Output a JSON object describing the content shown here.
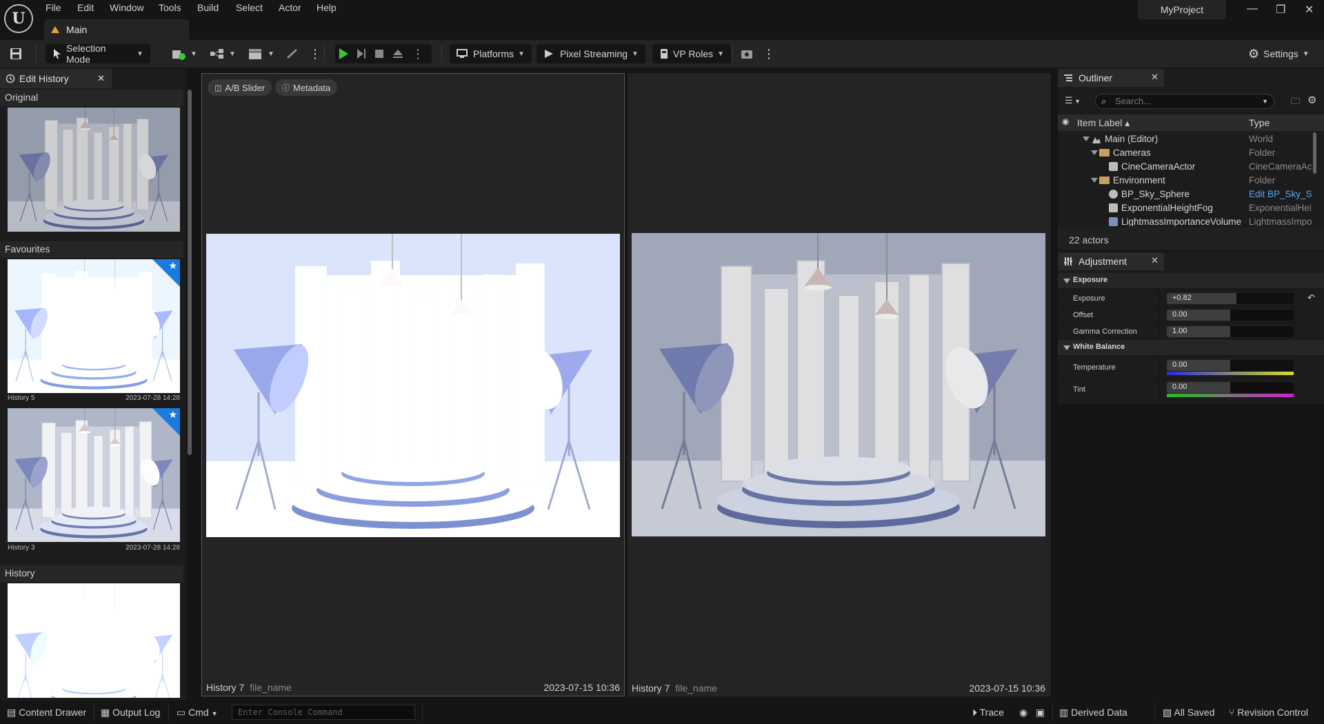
{
  "menubar": {
    "logo": "U",
    "menus": [
      "File",
      "Edit",
      "Window",
      "Tools",
      "Build",
      "Select",
      "Actor",
      "Help"
    ],
    "tab_label": "Main",
    "project_name": "MyProject",
    "window_controls": {
      "minimize": "—",
      "restore": "❐",
      "close": "✕"
    }
  },
  "toolbar": {
    "selection_mode": "Selection Mode",
    "platforms": "Platforms",
    "pixel_streaming": "Pixel Streaming",
    "vp_roles": "VP Roles",
    "settings": "Settings"
  },
  "edit_history": {
    "tab_label": "Edit History",
    "original_label": "Original",
    "favourites_label": "Favourites",
    "history_label": "History",
    "favourites": [
      {
        "name": "History 5",
        "date": "2023-07-28 14:28"
      },
      {
        "name": "History 3",
        "date": "2023-07-28 14:28"
      }
    ]
  },
  "viewport": {
    "ab_slider": "A/B Slider",
    "metadata": "Metadata",
    "left": {
      "name": "History 7",
      "file": "file_name",
      "date": "2023-07-15 10:36"
    },
    "right": {
      "name": "History 7",
      "file": "file_name",
      "date": "2023-07-15 10:36"
    }
  },
  "outliner": {
    "tab_label": "Outliner",
    "search_placeholder": "Search...",
    "col_label": "Item Label",
    "col_type": "Type",
    "rows": [
      {
        "label": "Main (Editor)",
        "type": "World"
      },
      {
        "label": "Cameras",
        "type": "Folder"
      },
      {
        "label": "CineCameraActor",
        "type": "CineCameraAc"
      },
      {
        "label": "Environment",
        "type": "Folder"
      },
      {
        "label": "BP_Sky_Sphere",
        "type": "Edit BP_Sky_S"
      },
      {
        "label": "ExponentialHeightFog",
        "type": "ExponentialHei"
      },
      {
        "label": "LightmassImportanceVolume",
        "type": "LightmassImpo"
      }
    ],
    "count": "22 actors"
  },
  "adjustment": {
    "tab_label": "Adjustment",
    "exposure_group": "Exposure",
    "white_balance_group": "White Balance",
    "params": [
      {
        "label": "Exposure",
        "value": "+0.82",
        "fill": 0.55
      },
      {
        "label": "Offset",
        "value": "0.00",
        "fill": 0.5
      },
      {
        "label": "Gamma Correction",
        "value": "1.00",
        "fill": 0.5
      },
      {
        "label": "Temperature",
        "value": "0.00",
        "fill": 0.5
      },
      {
        "label": "Tint",
        "value": "0.00",
        "fill": 0.5
      }
    ]
  },
  "statusbar": {
    "content_drawer": "Content Drawer",
    "output_log": "Output Log",
    "cmd": "Cmd",
    "console_placeholder": "Enter Console Command",
    "trace": "Trace",
    "derived_data": "Derived Data",
    "all_saved": "All Saved",
    "revision_control": "Revision Control"
  }
}
